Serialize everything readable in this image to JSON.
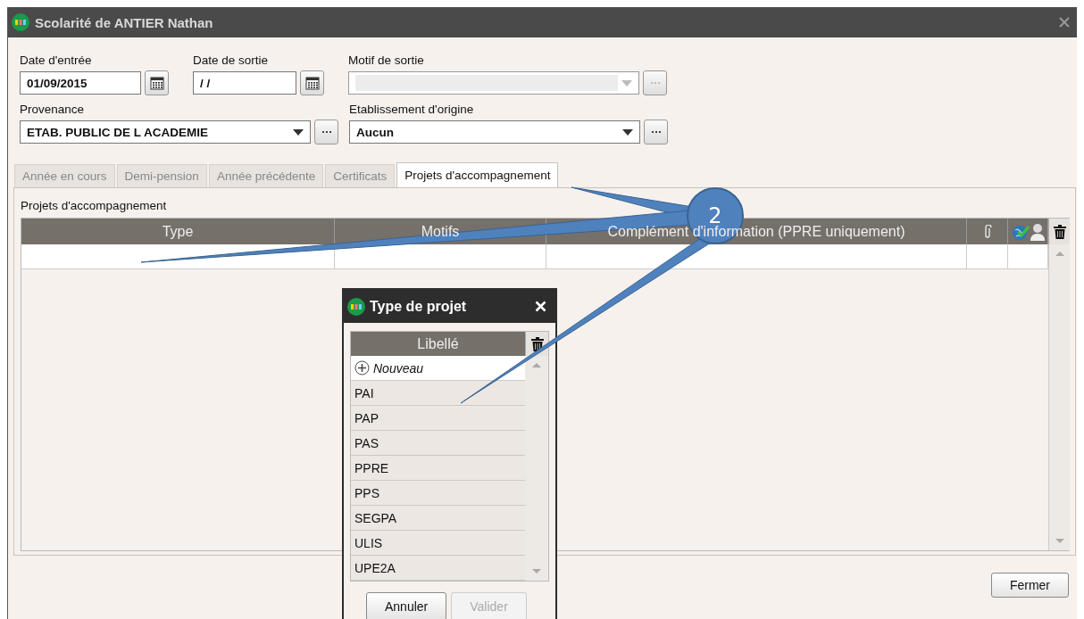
{
  "window": {
    "title": "Scolarité de ANTIER Nathan"
  },
  "fields": [
    {
      "label": "Date d'entrée",
      "kind": "date",
      "value": "01/09/2015"
    },
    {
      "label": "Date de sortie",
      "kind": "date",
      "value": "/ /"
    },
    {
      "label": "Motif de sortie",
      "kind": "combo",
      "disabled": true
    },
    {
      "label": "Provenance",
      "kind": "combo",
      "value": "ETAB. PUBLIC DE L ACADEMIE",
      "disabled": false
    },
    {
      "label": "Etablissement d'origine",
      "kind": "combo",
      "value": "Aucun",
      "disabled": false
    }
  ],
  "tabs": [
    {
      "label": "Année en cours",
      "selected": false
    },
    {
      "label": "Demi-pension",
      "selected": false
    },
    {
      "label": "Année précédente",
      "selected": false
    },
    {
      "label": "Certificats",
      "selected": false
    },
    {
      "label": "Projets d'accompagnement",
      "selected": true
    }
  ],
  "section_title": "Projets d'accompagnement",
  "table": {
    "columns": [
      "Type",
      "Motifs",
      "Complément d'information (PPRE uniquement)"
    ]
  },
  "dialog": {
    "title": "Type de projet",
    "column": "Libellé",
    "new_item": "Nouveau",
    "items": [
      "PAI",
      "PAP",
      "PAS",
      "PPRE",
      "PPS",
      "SEGPA",
      "ULIS",
      "UPE2A"
    ],
    "buttons": [
      {
        "label": "Annuler",
        "disabled": false
      },
      {
        "label": "Valider",
        "disabled": true
      }
    ]
  },
  "close_button": "Fermer",
  "callout": {
    "number": "2"
  }
}
